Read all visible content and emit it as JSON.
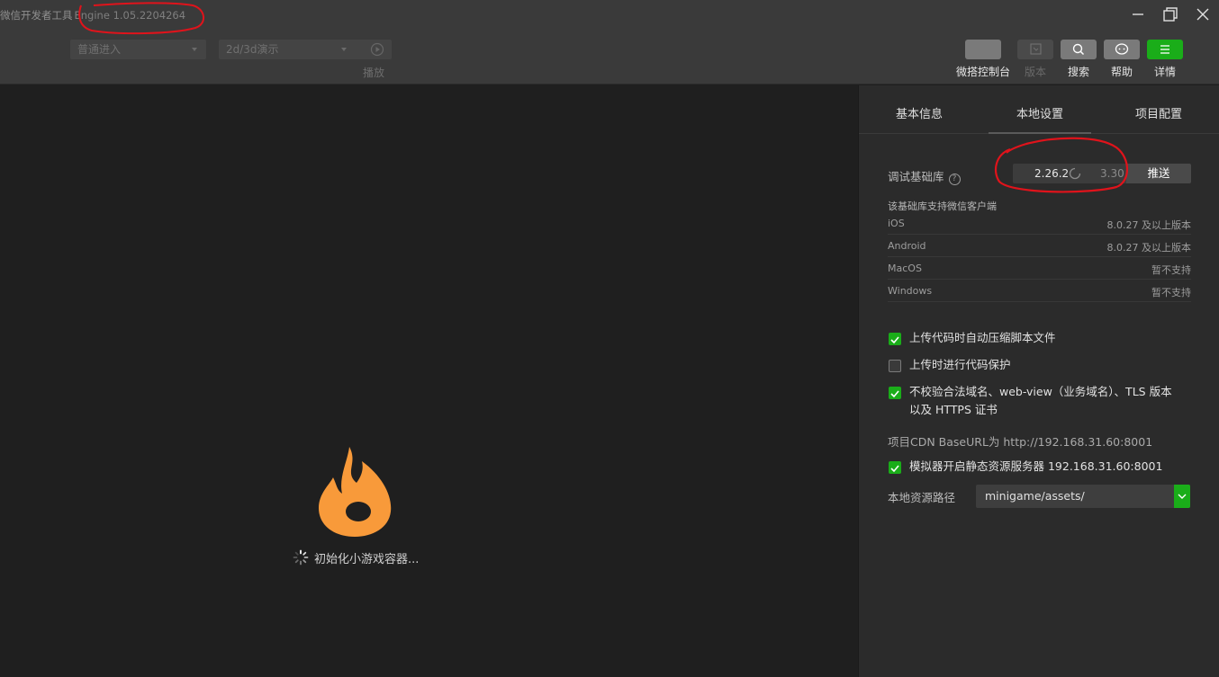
{
  "titlebar": {
    "app_title": "微信开发者工具",
    "engine": "Engine 1.05.2204264"
  },
  "toolbar": {
    "mode_select": "普通进入",
    "demo_select": "2d/3d演示",
    "play_label": "播放",
    "buttons": [
      {
        "label": "微搭控制台",
        "color": "#7a7a7a"
      },
      {
        "label": "版本",
        "color": "#4a4a4a"
      },
      {
        "label": "搜索",
        "color": "#7a7a7a"
      },
      {
        "label": "帮助",
        "color": "#7a7a7a"
      },
      {
        "label": "详情",
        "color": "#1aad19"
      }
    ]
  },
  "simulator": {
    "loading_text": "初始化小游戏容器..."
  },
  "panel": {
    "tabs": [
      "基本信息",
      "本地设置",
      "项目配置"
    ],
    "active_tab": "本地设置",
    "debug_lib_label": "调试基础库",
    "version_current": "2.26.2",
    "version_next": "3.30",
    "push_label": "推送",
    "support_title": "该基础库支持微信客户端",
    "platforms": [
      {
        "name": "iOS",
        "value": "8.0.27 及以上版本"
      },
      {
        "name": "Android",
        "value": "8.0.27 及以上版本"
      },
      {
        "name": "MacOS",
        "value": "暂不支持"
      },
      {
        "name": "Windows",
        "value": "暂不支持"
      }
    ],
    "checkboxes": [
      {
        "label": "上传代码时自动压缩脚本文件",
        "checked": true
      },
      {
        "label": "上传时进行代码保护",
        "checked": false
      },
      {
        "label": "不校验合法域名、web-view（业务域名）、TLS 版本以及 HTTPS 证书",
        "checked": true
      }
    ],
    "cdn_text": "项目CDN BaseURL为 http://192.168.31.60:8001",
    "static_server": {
      "label": "模拟器开启静态资源服务器 192.168.31.60:8001",
      "checked": true
    },
    "local_path_label": "本地资源路径",
    "local_path_value": "minigame/assets/"
  },
  "colors": {
    "accent": "#1aad19",
    "annotation": "#e0131b",
    "flame": "#f89a3a"
  }
}
